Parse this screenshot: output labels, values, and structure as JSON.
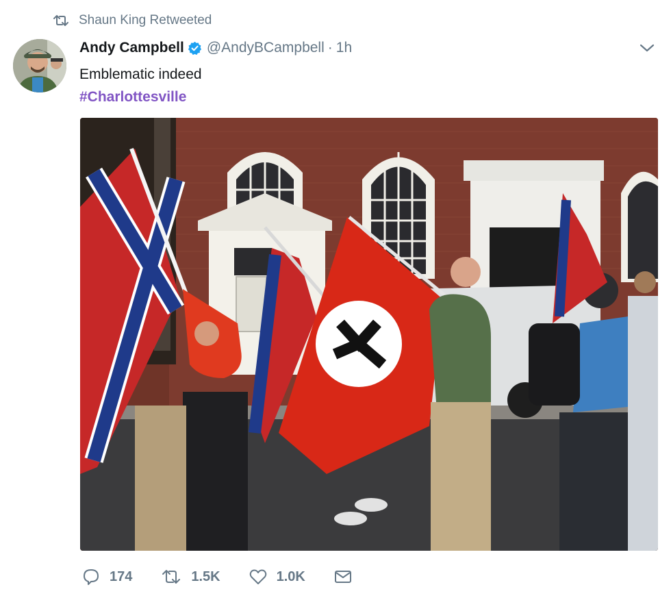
{
  "retweet_context": {
    "icon": "retweet-icon",
    "label": "Shaun King Retweeted"
  },
  "author": {
    "name": "Andy Campbell",
    "verified": true,
    "handle": "@AndyBCampbell",
    "separator": "·",
    "time": "1h"
  },
  "tweet": {
    "text": "Emblematic indeed",
    "hashtag": "#Charlottesville"
  },
  "actions": {
    "reply_count": "174",
    "retweet_count": "1.5K",
    "like_count": "1.0K"
  },
  "colors": {
    "text": "#14171a",
    "muted": "#657786",
    "hashtag": "#8155c4",
    "verified": "#1da1f2"
  },
  "icons": [
    "retweet-icon",
    "verified-badge-icon",
    "chevron-down-icon",
    "reply-icon",
    "retweet-icon",
    "like-icon",
    "direct-message-icon"
  ]
}
